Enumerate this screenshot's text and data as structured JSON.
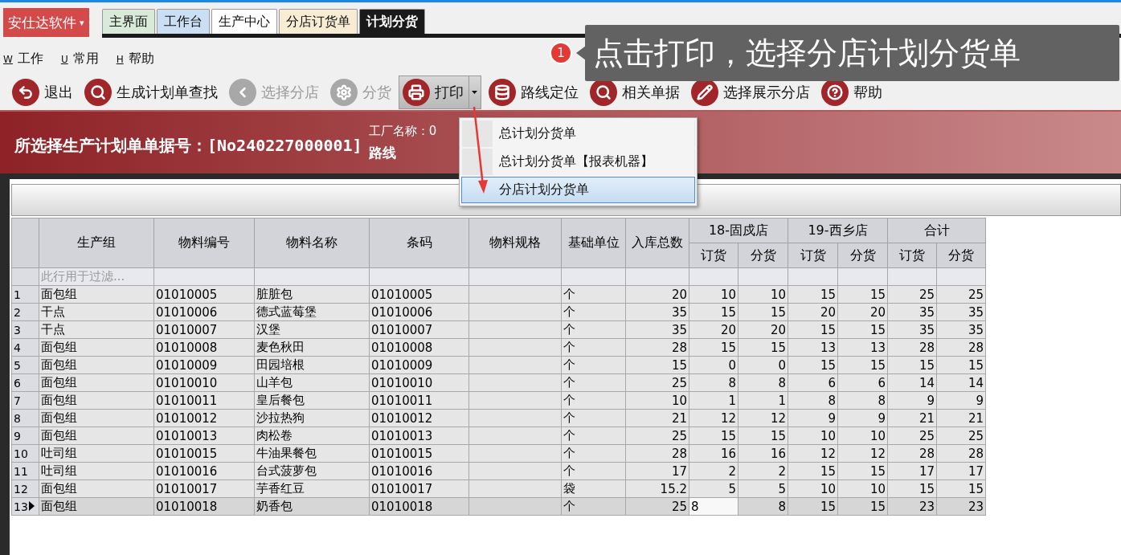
{
  "brand": {
    "label": "安仕达软件",
    "caret": "▾"
  },
  "tabs": [
    {
      "label": "主界面",
      "color": "#d9ead9",
      "selected": false
    },
    {
      "label": "工作台",
      "color": "#cadff3",
      "selected": false
    },
    {
      "label": "生产中心",
      "color": "#ffffff",
      "selected": false
    },
    {
      "label": "分店订货单",
      "color": "#f8edd4",
      "selected": false
    },
    {
      "label": "计划分货",
      "color": "#1a1a1a",
      "selected": true
    }
  ],
  "menu": [
    {
      "key": "W",
      "label": "工作"
    },
    {
      "key": "U",
      "label": "常用"
    },
    {
      "key": "H",
      "label": "帮助"
    }
  ],
  "toolbar": [
    {
      "label": "退出",
      "disabled": false,
      "pressed": false
    },
    {
      "label": "生成计划单查找",
      "disabled": false,
      "pressed": false
    },
    {
      "label": "选择分店",
      "disabled": true,
      "pressed": false
    },
    {
      "label": "分货",
      "disabled": true,
      "pressed": false
    },
    {
      "label": "打印",
      "disabled": false,
      "pressed": true,
      "dropdown": true
    },
    {
      "label": "路线定位",
      "disabled": false,
      "pressed": false
    },
    {
      "label": "相关单据",
      "disabled": false,
      "pressed": false
    },
    {
      "label": "选择展示分店",
      "disabled": false,
      "pressed": false
    },
    {
      "label": "帮助",
      "disabled": false,
      "pressed": false
    }
  ],
  "header": {
    "title": "所选择生产计划单单据号：[No240227000001]",
    "factory": "工厂名称：0",
    "route": "路线"
  },
  "print_menu": [
    {
      "label": "总计划分货单",
      "selected": false
    },
    {
      "label": "总计划分货单【报表机器】",
      "selected": false
    },
    {
      "label": "分店计划分货单",
      "selected": true
    }
  ],
  "annotation": {
    "badge": "1",
    "text": "点击打印，选择分店计划分货单"
  },
  "table": {
    "columns": [
      "生产组",
      "物料编号",
      "物料名称",
      "条码",
      "物料规格",
      "基础单位",
      "入库总数"
    ],
    "stores": [
      {
        "name": "18-固戍店",
        "sub": [
          "订货",
          "分货"
        ]
      },
      {
        "name": "19-西乡店",
        "sub": [
          "订货",
          "分货"
        ]
      },
      {
        "name": "合计",
        "sub": [
          "订货",
          "分货"
        ]
      }
    ],
    "filter_placeholder": "此行用于过滤...",
    "rows": [
      {
        "no": "1",
        "group": "面包组",
        "code": "01010005",
        "name": "脏脏包",
        "barcode": "01010005",
        "unit": "个",
        "total": "20",
        "values": [
          "10",
          "10",
          "15",
          "15",
          "25",
          "25"
        ],
        "selected": false
      },
      {
        "no": "2",
        "group": "干点",
        "code": "01010006",
        "name": "德式蓝莓堡",
        "barcode": "01010006",
        "unit": "个",
        "total": "35",
        "values": [
          "15",
          "15",
          "20",
          "20",
          "35",
          "35"
        ],
        "selected": false
      },
      {
        "no": "3",
        "group": "干点",
        "code": "01010007",
        "name": "汉堡",
        "barcode": "01010007",
        "unit": "个",
        "total": "35",
        "values": [
          "20",
          "20",
          "15",
          "15",
          "35",
          "35"
        ],
        "selected": false
      },
      {
        "no": "4",
        "group": "面包组",
        "code": "01010008",
        "name": "麦色秋田",
        "barcode": "01010008",
        "unit": "个",
        "total": "28",
        "values": [
          "15",
          "15",
          "13",
          "13",
          "28",
          "28"
        ],
        "selected": false
      },
      {
        "no": "5",
        "group": "面包组",
        "code": "01010009",
        "name": "田园培根",
        "barcode": "01010009",
        "unit": "个",
        "total": "15",
        "values": [
          "0",
          "0",
          "15",
          "15",
          "15",
          "15"
        ],
        "selected": false
      },
      {
        "no": "6",
        "group": "面包组",
        "code": "01010010",
        "name": "山羊包",
        "barcode": "01010010",
        "unit": "个",
        "total": "25",
        "values": [
          "8",
          "8",
          "6",
          "6",
          "14",
          "14"
        ],
        "selected": false
      },
      {
        "no": "7",
        "group": "面包组",
        "code": "01010011",
        "name": "皇后餐包",
        "barcode": "01010011",
        "unit": "个",
        "total": "10",
        "values": [
          "1",
          "1",
          "8",
          "8",
          "9",
          "9"
        ],
        "selected": false
      },
      {
        "no": "8",
        "group": "面包组",
        "code": "01010012",
        "name": "沙拉热狗",
        "barcode": "01010012",
        "unit": "个",
        "total": "21",
        "values": [
          "12",
          "12",
          "9",
          "9",
          "21",
          "21"
        ],
        "selected": false
      },
      {
        "no": "9",
        "group": "面包组",
        "code": "01010013",
        "name": "肉松卷",
        "barcode": "01010013",
        "unit": "个",
        "total": "25",
        "values": [
          "15",
          "15",
          "10",
          "10",
          "25",
          "25"
        ],
        "selected": false
      },
      {
        "no": "10",
        "group": "吐司组",
        "code": "01010015",
        "name": "牛油果餐包",
        "barcode": "01010015",
        "unit": "个",
        "total": "28",
        "values": [
          "16",
          "16",
          "12",
          "12",
          "28",
          "28"
        ],
        "selected": false
      },
      {
        "no": "11",
        "group": "吐司组",
        "code": "01010016",
        "name": "台式菠萝包",
        "barcode": "01010016",
        "unit": "个",
        "total": "17",
        "values": [
          "2",
          "2",
          "15",
          "15",
          "17",
          "17"
        ],
        "selected": false
      },
      {
        "no": "12",
        "group": "面包组",
        "code": "01010017",
        "name": "芋香红豆",
        "barcode": "01010017",
        "unit": "袋",
        "total": "15.2",
        "values": [
          "5",
          "5",
          "10",
          "10",
          "15",
          "15"
        ],
        "selected": false
      },
      {
        "no": "13",
        "group": "面包组",
        "code": "01010018",
        "name": "奶香包",
        "barcode": "01010018",
        "unit": "个",
        "total": "25",
        "values": [
          "8",
          "8",
          "15",
          "15",
          "23",
          "23"
        ],
        "selected": true
      }
    ]
  }
}
